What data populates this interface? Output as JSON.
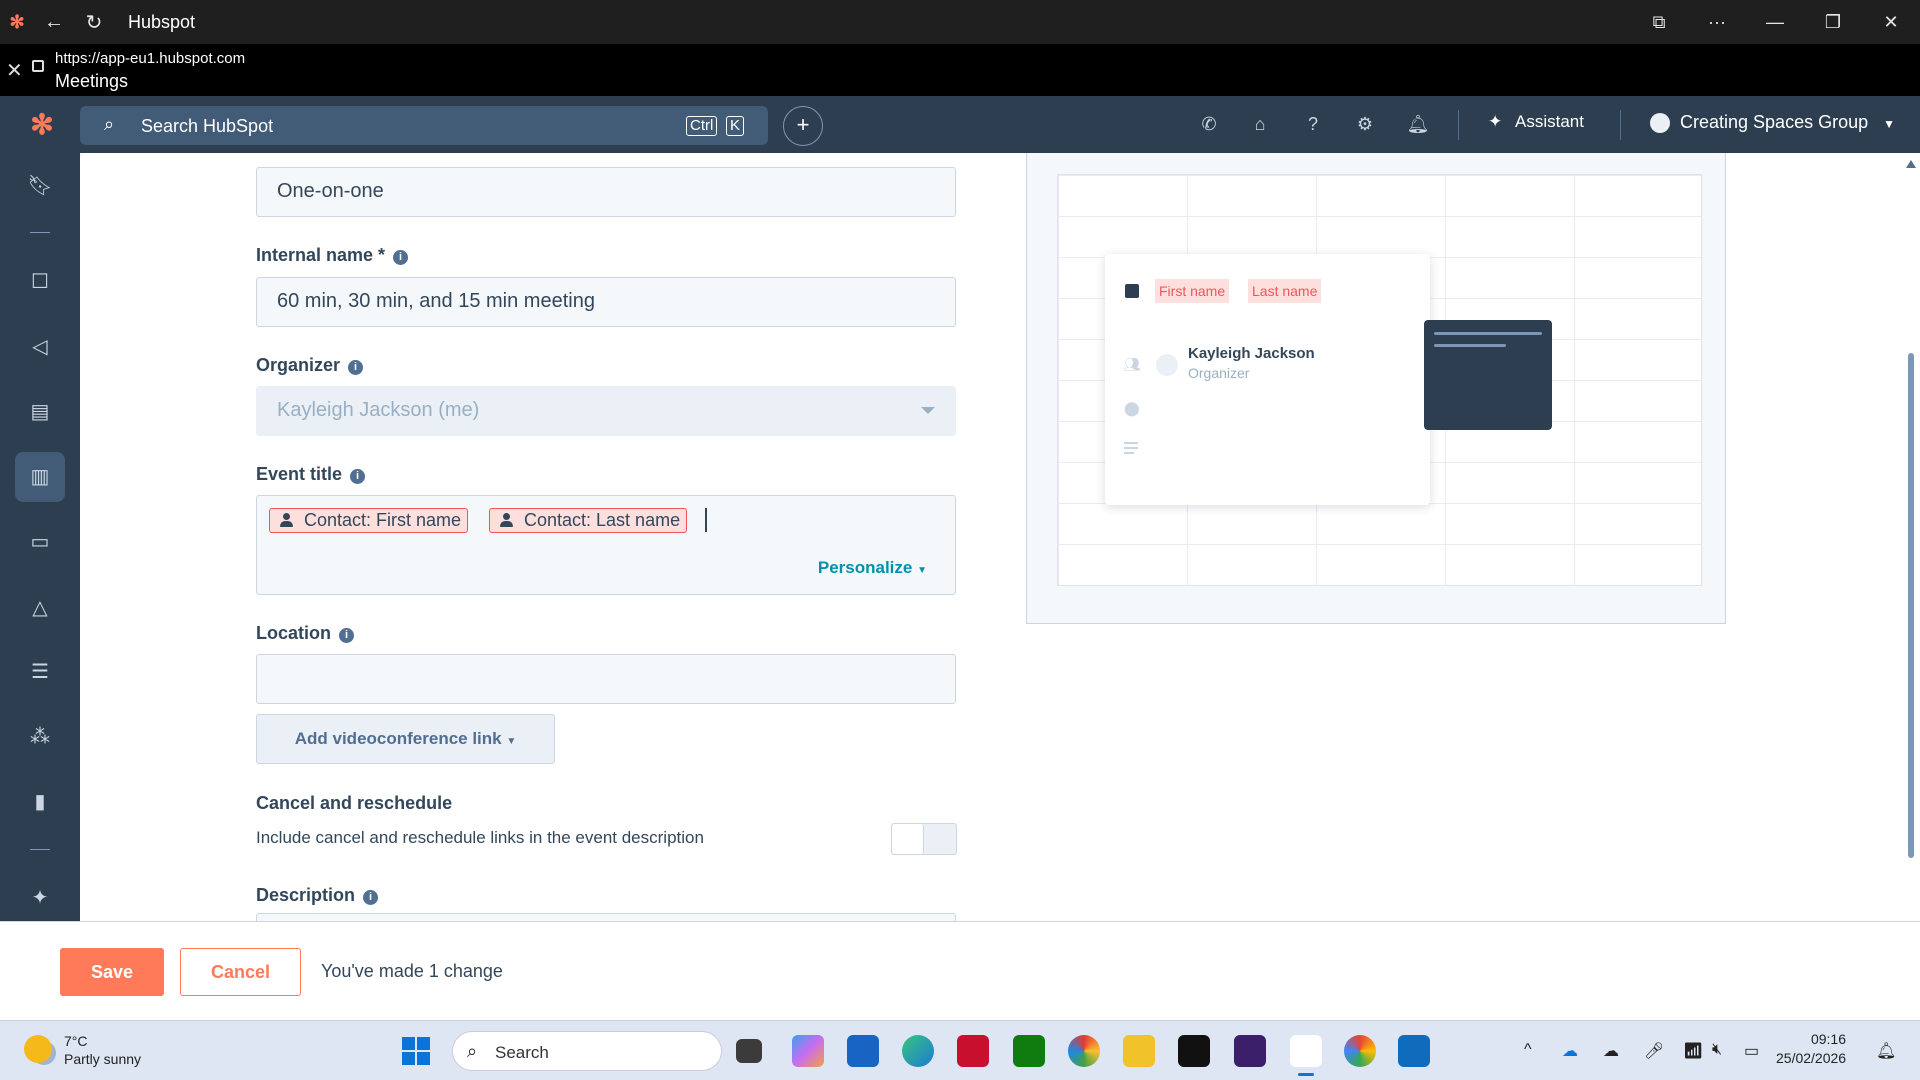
{
  "browser": {
    "app_title": "Hubspot",
    "url": "https://app-eu1.hubspot.com",
    "page_title": "Meetings"
  },
  "topnav": {
    "search_placeholder": "Search HubSpot",
    "shortcut_ctrl": "Ctrl",
    "shortcut_k": "K",
    "assistant_label": "Assistant",
    "account_name": "Creating Spaces Group"
  },
  "form": {
    "meeting_type_value": "One-on-one",
    "internal_name_label": "Internal name *",
    "internal_name_value": "60 min, 30 min, and 15 min meeting",
    "organizer_label": "Organizer",
    "organizer_value": "Kayleigh Jackson (me)",
    "event_title_label": "Event title",
    "event_title_tokens": [
      "Contact: First name",
      "Contact: Last name"
    ],
    "personalize_label": "Personalize",
    "location_label": "Location",
    "location_value": "",
    "videoconference_label": "Add videoconference link",
    "cancel_reschedule_label": "Cancel and reschedule",
    "cancel_reschedule_desc": "Include cancel and reschedule links in the event description",
    "cancel_reschedule_enabled": false,
    "description_label": "Description"
  },
  "preview": {
    "first_name_pill": "First name",
    "last_name_pill": "Last name",
    "organizer_name": "Kayleigh Jackson",
    "organizer_role": "Organizer"
  },
  "footer": {
    "save_label": "Save",
    "cancel_label": "Cancel",
    "changes_text": "You've made 1 change"
  },
  "taskbar": {
    "temperature": "7°C",
    "weather": "Partly sunny",
    "search_label": "Search",
    "time": "09:16",
    "date": "25/02/2026"
  },
  "colors": {
    "nav_bg": "#2d3e50",
    "accent": "#ff7a59",
    "link": "#0091ae",
    "token_border": "#f2545b"
  }
}
